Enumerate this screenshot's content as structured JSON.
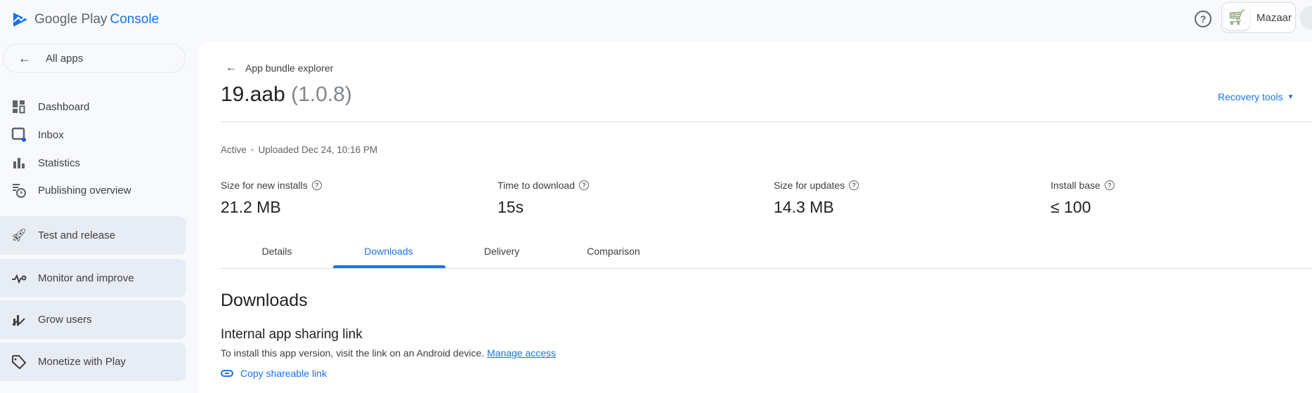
{
  "header": {
    "brand_google_play": "Google Play",
    "brand_console": "Console",
    "account_name": "Mazaar"
  },
  "sidebar": {
    "all_apps": "All apps",
    "items": [
      {
        "label": "Dashboard"
      },
      {
        "label": "Inbox"
      },
      {
        "label": "Statistics"
      },
      {
        "label": "Publishing overview"
      }
    ],
    "groups": [
      {
        "label": "Test and release"
      },
      {
        "label": "Monitor and improve"
      },
      {
        "label": "Grow users"
      },
      {
        "label": "Monetize with Play"
      }
    ]
  },
  "page": {
    "back_label": "App bundle explorer",
    "title": "19.aab",
    "version": "(1.0.8)",
    "recovery_tools": "Recovery tools",
    "status": "Active",
    "uploaded": "Uploaded Dec 24, 10:16 PM",
    "stats": [
      {
        "label": "Size for new installs",
        "value": "21.2 MB"
      },
      {
        "label": "Time to download",
        "value": "15s"
      },
      {
        "label": "Size for updates",
        "value": "14.3 MB"
      },
      {
        "label": "Install base",
        "value": "≤ 100"
      }
    ],
    "tabs": [
      {
        "label": "Details"
      },
      {
        "label": "Downloads"
      },
      {
        "label": "Delivery"
      },
      {
        "label": "Comparison"
      }
    ],
    "section_title": "Downloads",
    "subsection_title": "Internal app sharing link",
    "description": "To install this app version, visit the link on an Android device.",
    "manage_access": "Manage access",
    "copy_link": "Copy shareable link"
  },
  "colors": {
    "accent": "#1a73e8",
    "background": "#f8f9fc",
    "group_bg": "#e8edf5"
  }
}
